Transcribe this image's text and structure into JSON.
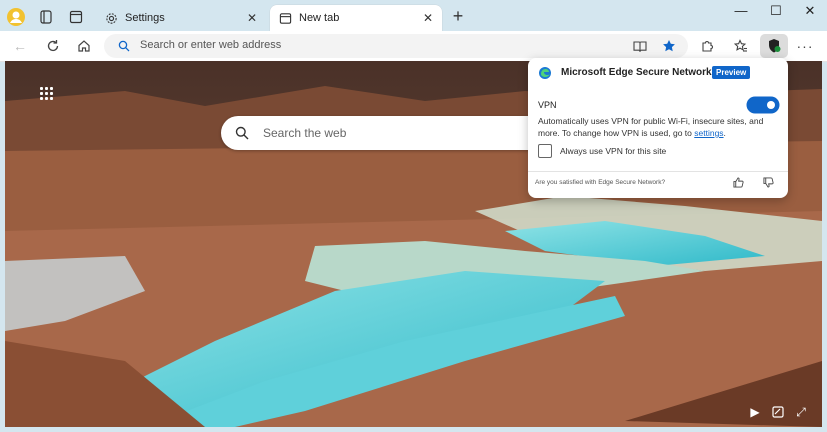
{
  "window": {
    "tabs": [
      {
        "title": "Settings"
      },
      {
        "title": "New tab"
      }
    ],
    "controls": {
      "minimize": "—",
      "maximize": "☐",
      "close": "✕"
    }
  },
  "toolbar": {
    "address_placeholder": "Search or enter web address"
  },
  "newtab": {
    "search_placeholder": "Search the web"
  },
  "vpn_popup": {
    "title": "Microsoft Edge Secure Network",
    "badge": "Preview",
    "vpn_label": "VPN",
    "vpn_enabled": true,
    "description_prefix": "Automatically uses VPN for public Wi-Fi, insecure sites, and more. To change how VPN is used, go to ",
    "description_link": "settings",
    "description_suffix": ".",
    "checkbox_label": "Always use VPN for this site",
    "checkbox_checked": false,
    "feedback_question": "Are you satisfied with Edge Secure Network?"
  },
  "colors": {
    "accent": "#1066c9",
    "titlebar": "#d4e6ef"
  }
}
